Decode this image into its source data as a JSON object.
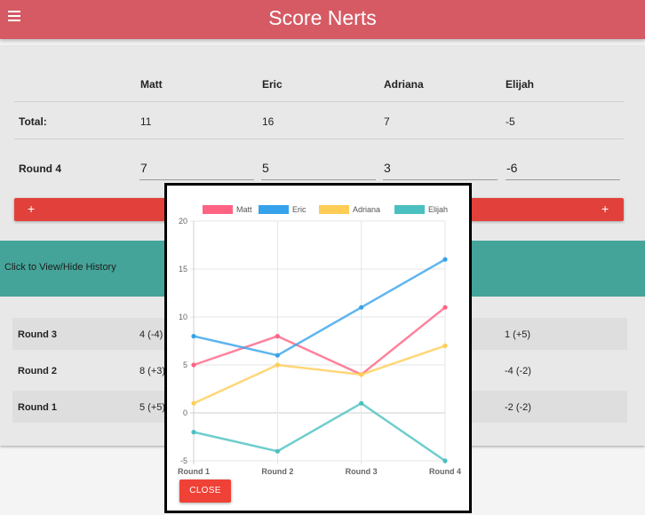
{
  "app": {
    "title": "Score Nerts"
  },
  "players": [
    "Matt",
    "Eric",
    "Adriana",
    "Elijah"
  ],
  "totals": {
    "label": "Total:",
    "values": [
      "11",
      "16",
      "7",
      "-5"
    ]
  },
  "current_round": {
    "label": "Round 4",
    "inputs": [
      "7",
      "5",
      "3",
      "-6"
    ]
  },
  "add_button": {
    "left_label": "+",
    "right_label": "+"
  },
  "history": {
    "toggle_label": "Click to View/Hide History",
    "rounds": [
      {
        "label": "Round 3",
        "first": "4 (-4)",
        "last": "1 (+5)"
      },
      {
        "label": "Round 2",
        "first": "8 (+3)",
        "last": "-4 (-2)"
      },
      {
        "label": "Round 1",
        "first": "5 (+5)",
        "last": "-2 (-2)"
      }
    ]
  },
  "modal": {
    "close_label": "CLOSE"
  },
  "chart_data": {
    "type": "line",
    "categories": [
      "Round 1",
      "Round 2",
      "Round 3",
      "Round 4"
    ],
    "series": [
      {
        "name": "Matt",
        "values": [
          5,
          8,
          4,
          11
        ],
        "color": "#ff6384"
      },
      {
        "name": "Eric",
        "values": [
          8,
          6,
          11,
          16
        ],
        "color": "#36a2eb"
      },
      {
        "name": "Adriana",
        "values": [
          1,
          5,
          4,
          7
        ],
        "color": "#ffcd56"
      },
      {
        "name": "Elijah",
        "values": [
          -2,
          -4,
          1,
          -5
        ],
        "color": "#4bc0c0"
      }
    ],
    "ylim": [
      -5,
      20
    ],
    "yticks": [
      -5,
      0,
      5,
      10,
      15,
      20
    ],
    "grid": true,
    "legend": "top"
  },
  "colors": {
    "appbar": "#d65a64",
    "history_bar": "#45a499",
    "add_button": "#e1413a",
    "close_button": "#ef4136"
  }
}
